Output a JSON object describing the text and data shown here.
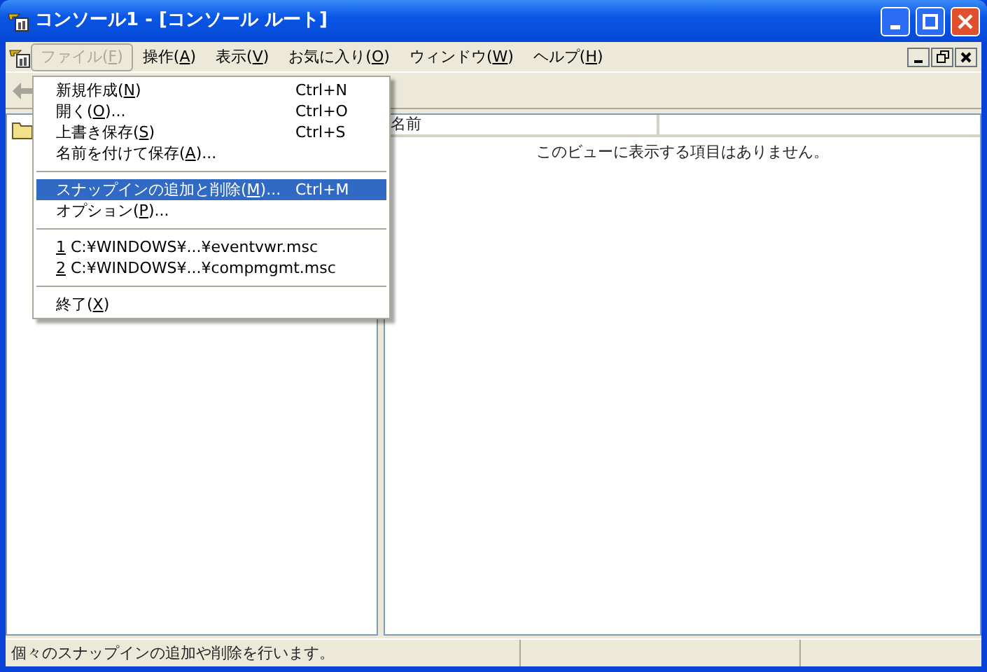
{
  "window": {
    "title": "コンソール1 - [コンソール ルート]"
  },
  "menubar": [
    {
      "text": "ファイル(",
      "access_key": "F",
      "text_after": ")",
      "selected": true
    },
    {
      "text": "操作(",
      "access_key": "A",
      "text_after": ")",
      "selected": false
    },
    {
      "text": "表示(",
      "access_key": "V",
      "text_after": ")",
      "selected": false
    },
    {
      "text": "お気に入り(",
      "access_key": "O",
      "text_after": ")",
      "selected": false
    },
    {
      "text": "ウィンドウ(",
      "access_key": "W",
      "text_after": ")",
      "selected": false
    },
    {
      "text": "ヘルプ(",
      "access_key": "H",
      "text_after": ")",
      "selected": false
    }
  ],
  "file_menu": [
    {
      "kind": "item",
      "text": "新規作成(",
      "access_key": "N",
      "text_after": ")",
      "shortcut": "Ctrl+N",
      "selected": false
    },
    {
      "kind": "item",
      "text": "開く(",
      "access_key": "O",
      "text_after": ")...",
      "shortcut": "Ctrl+O",
      "selected": false
    },
    {
      "kind": "item",
      "text": "上書き保存(",
      "access_key": "S",
      "text_after": ")",
      "shortcut": "Ctrl+S",
      "selected": false
    },
    {
      "kind": "item",
      "text": "名前を付けて保存(",
      "access_key": "A",
      "text_after": ")...",
      "selected": false
    },
    {
      "kind": "separator"
    },
    {
      "kind": "item",
      "text": "スナップインの追加と削除(",
      "access_key": "M",
      "text_after": ")...",
      "shortcut": "Ctrl+M",
      "selected": true
    },
    {
      "kind": "item",
      "text": "オプション(",
      "access_key": "P",
      "text_after": ")...",
      "selected": false
    },
    {
      "kind": "separator"
    },
    {
      "kind": "item",
      "access_key": "1",
      "text_after": " C:¥WINDOWS¥...¥eventvwr.msc",
      "selected": false
    },
    {
      "kind": "item",
      "access_key": "2",
      "text_after": " C:¥WINDOWS¥...¥compmgmt.msc",
      "selected": false
    },
    {
      "kind": "separator"
    },
    {
      "kind": "item",
      "text": "終了(",
      "access_key": "X",
      "text_after": ")",
      "selected": false
    }
  ],
  "list_view": {
    "columns": [
      "名前"
    ],
    "empty_message": "このビューに表示する項目はありません。"
  },
  "status_bar": [
    "個々のスナップインの追加や削除を行います。"
  ]
}
